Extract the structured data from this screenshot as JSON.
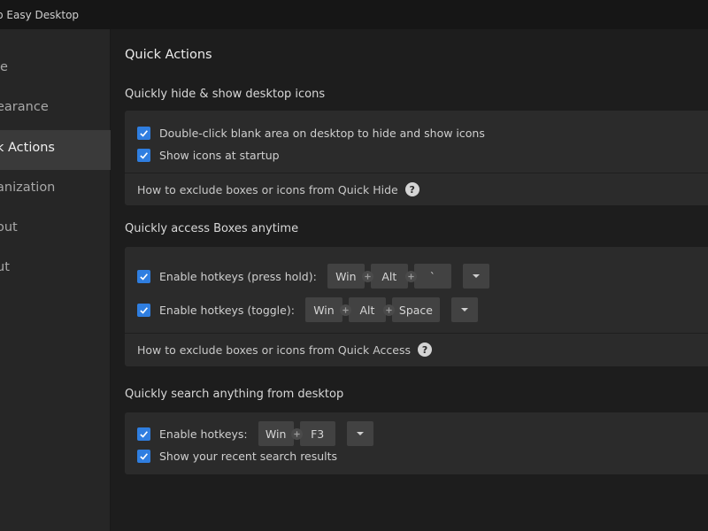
{
  "window": {
    "title": "p Easy Desktop"
  },
  "sidebar": {
    "items": [
      {
        "label": "le"
      },
      {
        "label": "earance"
      },
      {
        "label": "k Actions"
      },
      {
        "label": "anization"
      },
      {
        "label": "out"
      },
      {
        "label": "ut"
      }
    ],
    "active_index": 2
  },
  "main": {
    "title": "Quick Actions",
    "sections": {
      "hide_show": {
        "title": "Quickly hide & show desktop icons",
        "double_click": {
          "label": "Double-click blank area on desktop to hide and show icons",
          "checked": true
        },
        "show_startup": {
          "label": "Show icons at startup",
          "checked": true
        },
        "help_link": "How to exclude boxes or icons from Quick Hide"
      },
      "access": {
        "title": "Quickly access Boxes anytime",
        "press_hold": {
          "label": "Enable hotkeys (press hold):",
          "checked": true,
          "keys": [
            "Win",
            "Alt",
            "`"
          ]
        },
        "toggle": {
          "label": "Enable hotkeys (toggle):",
          "checked": true,
          "keys": [
            "Win",
            "Alt",
            "Space"
          ]
        },
        "help_link": "How to exclude boxes or icons from Quick Access"
      },
      "search": {
        "title": "Quickly search anything from desktop",
        "hotkeys": {
          "label": "Enable hotkeys:",
          "checked": true,
          "keys": [
            "Win",
            "F3"
          ]
        },
        "recent": {
          "label": "Show your recent search results",
          "checked": true
        }
      }
    }
  },
  "icons": {
    "help": "?",
    "checkbox": "check-icon",
    "combine": "plus-icon",
    "dropdown": "chevron-down-icon"
  },
  "colors": {
    "accent": "#2f7ee0",
    "sidebar_active": "#3a3a3a",
    "card": "#2b2b2b",
    "key": "#424242"
  }
}
